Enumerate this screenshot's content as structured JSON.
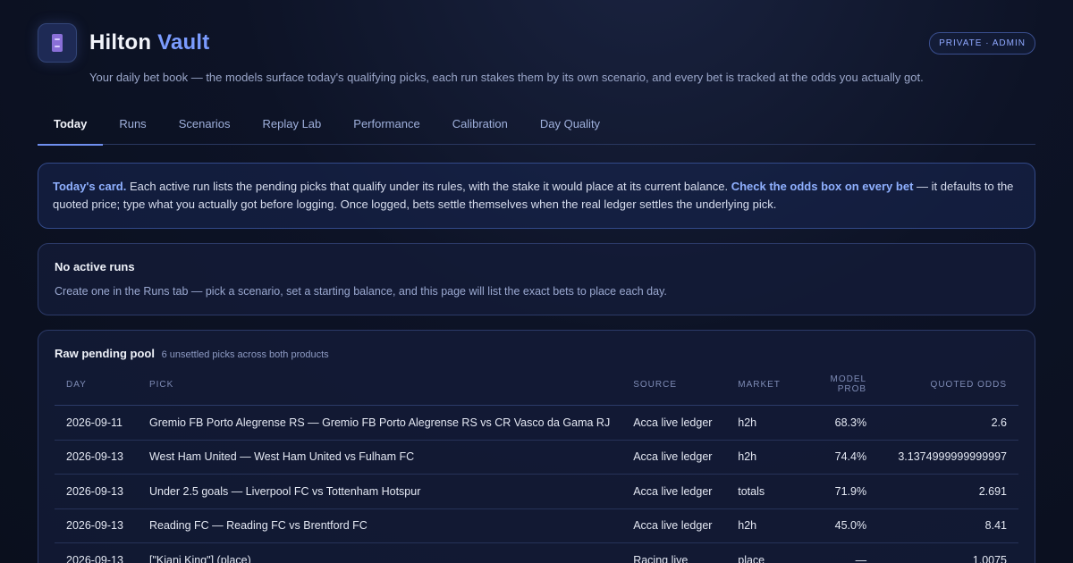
{
  "app": {
    "title_main": "Hilton",
    "title_accent": "Vault",
    "subtitle": "Your daily bet book — the models surface today's qualifying picks, each run stakes them by its own scenario, and every bet is tracked at the odds you actually got.",
    "badge": "PRIVATE · ADMIN",
    "icon": "archive-box-icon",
    "accent_color": "#7b9cff"
  },
  "tabs": [
    {
      "label": "Today",
      "active": true
    },
    {
      "label": "Runs"
    },
    {
      "label": "Scenarios"
    },
    {
      "label": "Replay Lab"
    },
    {
      "label": "Performance"
    },
    {
      "label": "Calibration"
    },
    {
      "label": "Day Quality"
    }
  ],
  "info": {
    "lead": "Today's card.",
    "text1": " Each active run lists the pending picks that qualify under its rules, with the stake it would place at its current balance. ",
    "emph": "Check the odds box on every bet",
    "text2": " — it defaults to the quoted price; type what you actually got before logging. Once logged, bets settle themselves when the real ledger settles the underlying pick."
  },
  "empty": {
    "title": "No active runs",
    "text": "Create one in the Runs tab — pick a scenario, set a starting balance, and this page will list the exact bets to place each day."
  },
  "pool": {
    "title": "Raw pending pool",
    "count_text": "6 unsettled picks across both products",
    "columns": {
      "day": "DAY",
      "pick": "PICK",
      "source": "SOURCE",
      "market": "MARKET",
      "prob": "MODEL PROB",
      "odds": "QUOTED ODDS"
    },
    "rows": [
      {
        "day": "2026-09-11",
        "pick": "Gremio FB Porto Alegrense RS — Gremio FB Porto Alegrense RS vs CR Vasco da Gama RJ",
        "source": "Acca live ledger",
        "market": "h2h",
        "prob": "68.3%",
        "odds": "2.6"
      },
      {
        "day": "2026-09-13",
        "pick": "West Ham United — West Ham United vs Fulham FC",
        "source": "Acca live ledger",
        "market": "h2h",
        "prob": "74.4%",
        "odds": "3.1374999999999997"
      },
      {
        "day": "2026-09-13",
        "pick": "Under 2.5 goals — Liverpool FC vs Tottenham Hotspur",
        "source": "Acca live ledger",
        "market": "totals",
        "prob": "71.9%",
        "odds": "2.691"
      },
      {
        "day": "2026-09-13",
        "pick": "Reading FC — Reading FC vs Brentford FC",
        "source": "Acca live ledger",
        "market": "h2h",
        "prob": "45.0%",
        "odds": "8.41"
      },
      {
        "day": "2026-09-13",
        "pick": "[\"Kiani King\"] (place)",
        "source": "Racing live",
        "market": "place",
        "prob": "—",
        "odds": "1.0075"
      }
    ]
  }
}
